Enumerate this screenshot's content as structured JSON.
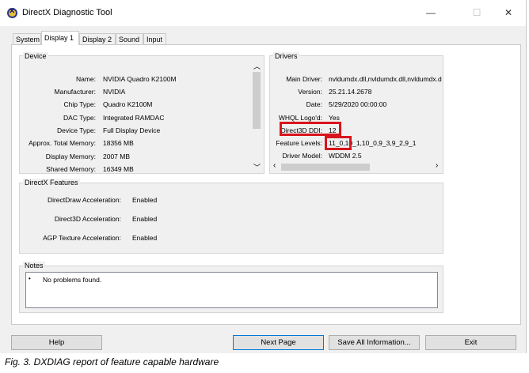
{
  "window": {
    "title": "DirectX Diagnostic Tool",
    "minimize": "—",
    "maximize": "☐",
    "close": "✕"
  },
  "tabs": [
    "System",
    "Display 1",
    "Display 2",
    "Sound",
    "Input"
  ],
  "active_tab": "Display 1",
  "device": {
    "title": "Device",
    "rows": [
      {
        "label": "Name:",
        "value": "NVIDIA Quadro K2100M"
      },
      {
        "label": "Manufacturer:",
        "value": "NVIDIA"
      },
      {
        "label": "Chip Type:",
        "value": "Quadro K2100M"
      },
      {
        "label": "DAC Type:",
        "value": "Integrated RAMDAC"
      },
      {
        "label": "Device Type:",
        "value": "Full Display Device"
      },
      {
        "label": "Approx. Total Memory:",
        "value": "18356 MB"
      },
      {
        "label": "Display Memory:",
        "value": "2007 MB"
      },
      {
        "label": "Shared Memory:",
        "value": "16349 MB"
      }
    ]
  },
  "drivers": {
    "title": "Drivers",
    "rows": [
      {
        "label": "Main Driver:",
        "value": "nvldumdx.dll,nvldumdx.dll,nvldumdx.d"
      },
      {
        "label": "Version:",
        "value": "25.21.14.2678"
      },
      {
        "label": "Date:",
        "value": "5/29/2020 00:00:00"
      },
      {
        "label": "WHQL Logo'd:",
        "value": "Yes"
      },
      {
        "label": "Direct3D DDI:",
        "value": "12"
      },
      {
        "label": "Feature Levels:",
        "value": "11_0,10_1,10_0,9_3,9_2,9_1"
      },
      {
        "label": "Driver Model:",
        "value": "WDDM 2.5"
      }
    ]
  },
  "features": {
    "title": "DirectX Features",
    "rows": [
      {
        "label": "DirectDraw Acceleration:",
        "value": "Enabled"
      },
      {
        "label": "Direct3D Acceleration:",
        "value": "Enabled"
      },
      {
        "label": "AGP Texture Acceleration:",
        "value": "Enabled"
      }
    ]
  },
  "notes": {
    "title": "Notes",
    "items": [
      "No problems found."
    ]
  },
  "buttons": {
    "help": "Help",
    "next_page": "Next Page",
    "save_all": "Save All Information...",
    "exit": "Exit"
  },
  "caption": "Fig. 3. DXDIAG report of feature capable hardware",
  "colors": {
    "highlight_box": "#d8141c",
    "focus_border": "#0078d7"
  }
}
